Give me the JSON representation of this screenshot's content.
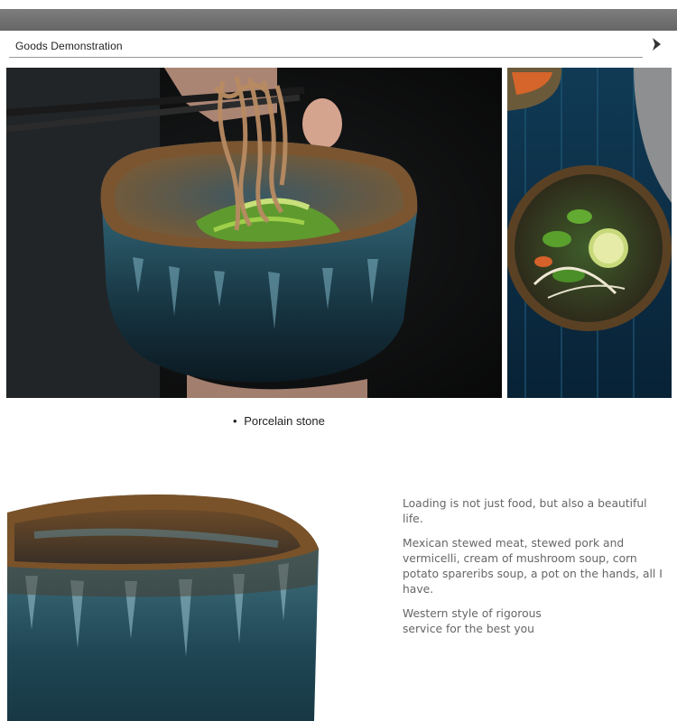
{
  "header": {
    "title": "Goods  Demonstration",
    "arrow_icon": "chevron-right-icon"
  },
  "photos": {
    "main": "bowl-with-noodles-photo",
    "side": "bowl-with-salad-photo",
    "detail": "bowl-closeup-photo"
  },
  "caption": {
    "bullet": "•",
    "text": "Porcelain stone"
  },
  "description": {
    "p1": "Loading is not just food, but also a beautiful life.",
    "p2": "Mexican stewed meat, stewed pork and vermicelli, cream of mushroom soup, corn potato spareribs soup, a pot on the hands, all I have.",
    "p3": "Western style of rigorous service for the  best you"
  },
  "colors": {
    "topbar": "#737373",
    "glaze_blue": "#3f7c8f",
    "glaze_brown": "#6b4a25",
    "background_dark": "#101010"
  }
}
